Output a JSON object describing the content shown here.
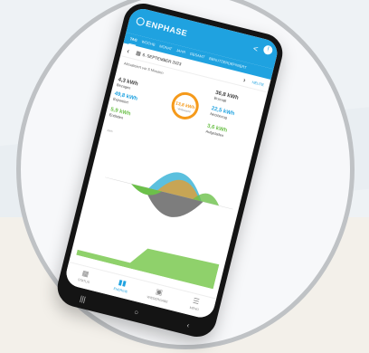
{
  "app": {
    "brand": "ENPHASE",
    "tabs": [
      "TAG",
      "WOCHE",
      "MONAT",
      "JAHR",
      "GESAMT",
      "BENUTZERDEFINIERT"
    ],
    "active_tab": "TAG"
  },
  "datebar": {
    "date": "6. SEPTEMBER 2023",
    "today": "HEUTE"
  },
  "updated": "Aktualisiert vor 5 Minuten",
  "flow": {
    "produced": {
      "value": "36,8 kWh",
      "label": "Erzeugt"
    },
    "consumed": {
      "value": "4,3 kWh",
      "label": "Bezogen"
    },
    "center": {
      "value": "13,8 kWh",
      "label": "Verbraucht"
    },
    "grid": {
      "value": "49,8 kWh",
      "label": "Exportiert"
    },
    "exported": {
      "value": "22,5 kWh",
      "label": "Netzbezug"
    },
    "battery_in": {
      "value": "3,6 kWh",
      "label": "Aufgeladen"
    },
    "battery_out": {
      "value": "5,9 kWh",
      "label": "Entladen"
    }
  },
  "chart": {
    "unit": "kWh"
  },
  "bottomnav": [
    "STATUS",
    "ENERGIE",
    "WIEDERGABE",
    "MENÜ"
  ],
  "colors": {
    "primary": "#1fa2e0",
    "solar": "#f59a1b",
    "consumption": "#5bc0de",
    "battery": "#6cc04a"
  }
}
